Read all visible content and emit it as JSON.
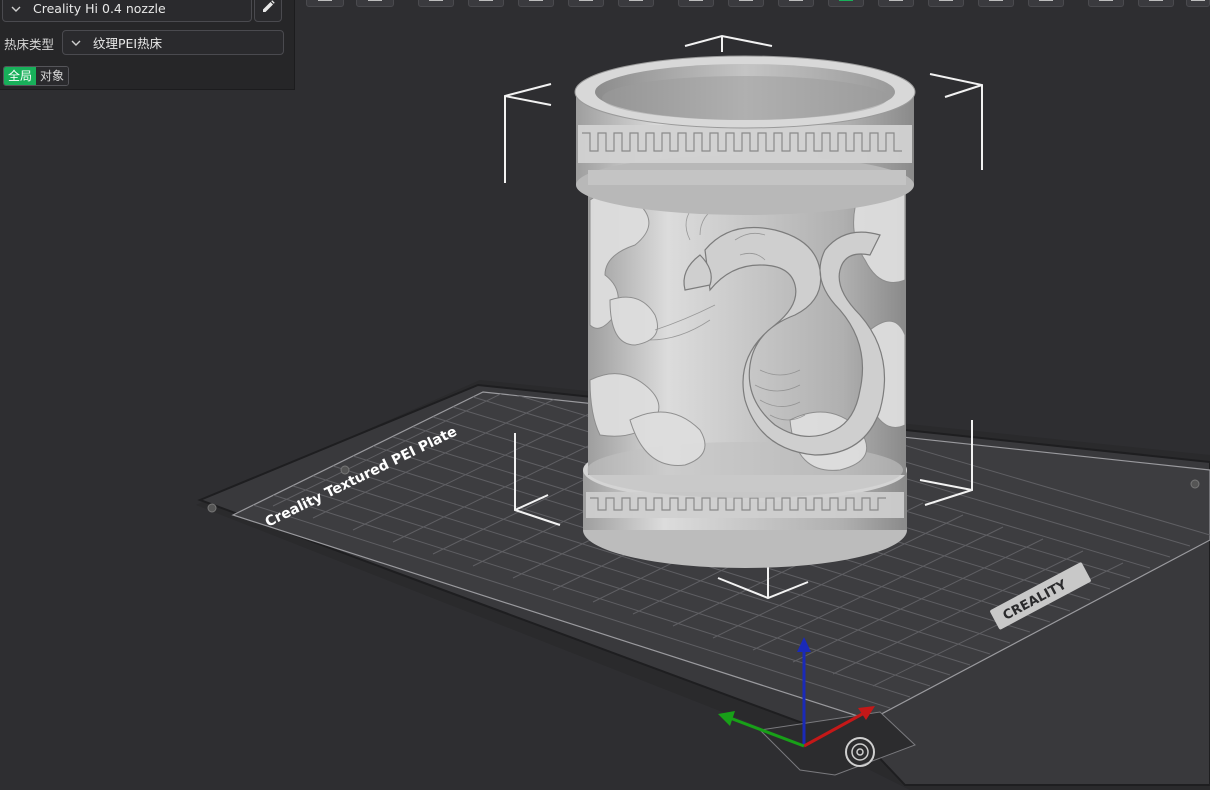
{
  "panel": {
    "printer": "Creality Hi 0.4 nozzle",
    "bed_type_label": "热床类型",
    "bed_type_value": "纹理PEI热床",
    "scope_options": [
      "全局",
      "对象"
    ],
    "scope_selected": "全局"
  },
  "viewport": {
    "plate_label": "Creality Textured PEI Plate",
    "brand_logo": "CREALITY"
  },
  "icons": {
    "edit": "pencil-icon",
    "dropdown": "chevron-down-icon"
  },
  "colors": {
    "accent": "#18b05a",
    "background": "#2e2e31",
    "plate": "#3b3b3e",
    "grid": "#6a6a6e",
    "axis_x": "#c41818",
    "axis_y": "#18a018",
    "axis_z": "#1a2ab8"
  }
}
